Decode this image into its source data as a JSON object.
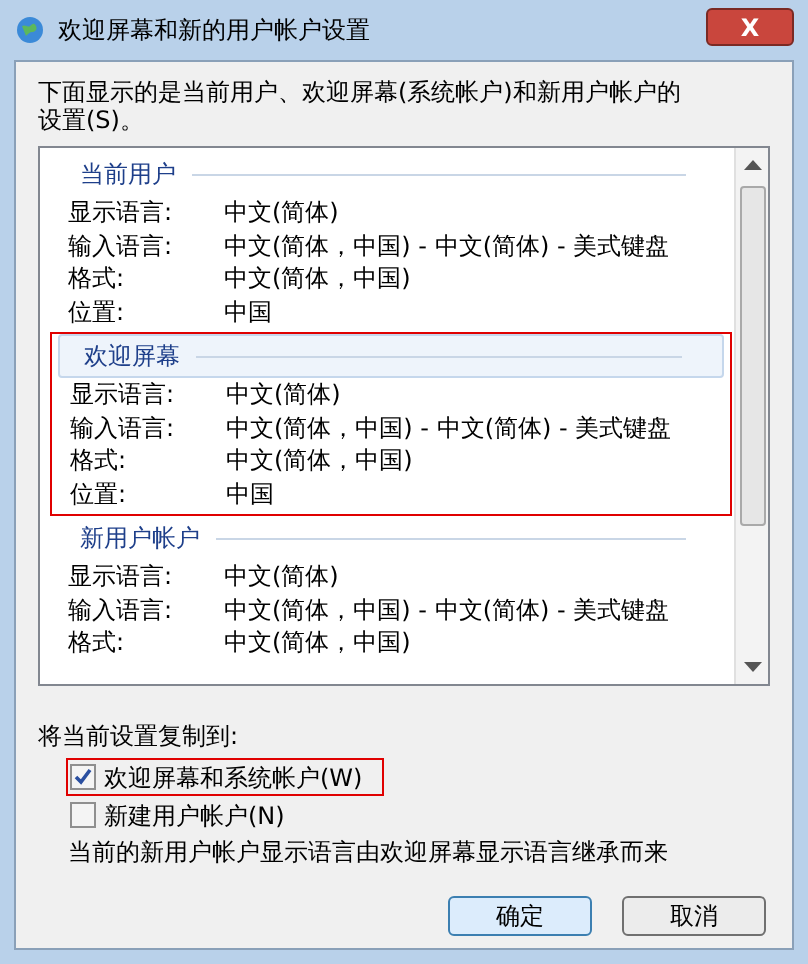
{
  "window": {
    "title": "欢迎屏幕和新的用户帐户设置",
    "close": "X"
  },
  "intro": "下面显示的是当前用户、欢迎屏幕(系统帐户)和新用户帐户的设置(S)。",
  "sections": [
    {
      "title": "当前用户",
      "highlighted": false,
      "rows": [
        {
          "label": "显示语言:",
          "value": "中文(简体)"
        },
        {
          "label": "输入语言:",
          "value": "中文(简体，中国) - 中文(简体) - 美式键盘"
        },
        {
          "label": "格式:",
          "value": "中文(简体，中国)"
        },
        {
          "label": "位置:",
          "value": "中国"
        }
      ]
    },
    {
      "title": "欢迎屏幕",
      "highlighted": true,
      "rows": [
        {
          "label": "显示语言:",
          "value": "中文(简体)"
        },
        {
          "label": "输入语言:",
          "value": "中文(简体，中国) - 中文(简体) - 美式键盘"
        },
        {
          "label": "格式:",
          "value": "中文(简体，中国)"
        },
        {
          "label": "位置:",
          "value": "中国"
        }
      ]
    },
    {
      "title": "新用户帐户",
      "highlighted": false,
      "rows": [
        {
          "label": "显示语言:",
          "value": "中文(简体)"
        },
        {
          "label": "输入语言:",
          "value": "中文(简体，中国) - 中文(简体) - 美式键盘"
        },
        {
          "label": "格式:",
          "value": "中文(简体，中国)"
        }
      ]
    }
  ],
  "copy_label": "将当前设置复制到:",
  "options": [
    {
      "label": "欢迎屏幕和系统帐户(W)",
      "checked": true,
      "highlighted": true
    },
    {
      "label": "新建用户帐户(N)",
      "checked": false,
      "highlighted": false
    }
  ],
  "note": "当前的新用户帐户显示语言由欢迎屏幕显示语言继承而来",
  "buttons": [
    {
      "label": "确定",
      "default": true
    },
    {
      "label": "取消",
      "default": false
    }
  ]
}
